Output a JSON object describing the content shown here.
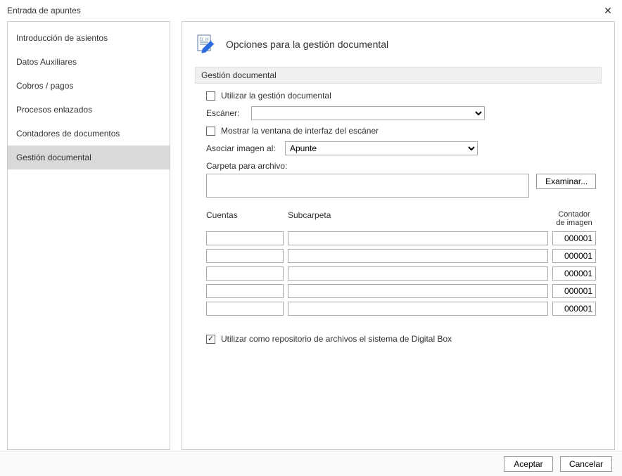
{
  "window": {
    "title": "Entrada de apuntes"
  },
  "nav": {
    "items": [
      {
        "label": "Introducción de asientos"
      },
      {
        "label": "Datos Auxiliares"
      },
      {
        "label": "Cobros / pagos"
      },
      {
        "label": "Procesos enlazados"
      },
      {
        "label": "Contadores de documentos"
      },
      {
        "label": "Gestión documental"
      }
    ],
    "selectedIndex": 5
  },
  "panel": {
    "title": "Opciones para la gestión documental",
    "section": "Gestión documental",
    "useDocMgmt": {
      "label": "Utilizar la gestión documental",
      "checked": false
    },
    "scannerLabel": "Escáner:",
    "scannerValue": "",
    "showScannerUi": {
      "label": "Mostrar la ventana de interfaz del escáner",
      "checked": false
    },
    "assocLabel": "Asociar imagen al:",
    "assocValue": "Apunte",
    "folderLabel": "Carpeta para archivo:",
    "folderValue": "",
    "browse": "Examinar...",
    "gridHeaders": {
      "cuentas": "Cuentas",
      "sub": "Subcarpeta",
      "contLine1": "Contador",
      "contLine2": "de imagen"
    },
    "rows": [
      {
        "cuenta": "",
        "sub": "",
        "cont": "000001"
      },
      {
        "cuenta": "",
        "sub": "",
        "cont": "000001"
      },
      {
        "cuenta": "",
        "sub": "",
        "cont": "000001"
      },
      {
        "cuenta": "",
        "sub": "",
        "cont": "000001"
      },
      {
        "cuenta": "",
        "sub": "",
        "cont": "000001"
      }
    ],
    "digitalBox": {
      "label": "Utilizar como repositorio de archivos el sistema de Digital Box",
      "checked": true
    }
  },
  "footer": {
    "ok": "Aceptar",
    "cancel": "Cancelar"
  }
}
